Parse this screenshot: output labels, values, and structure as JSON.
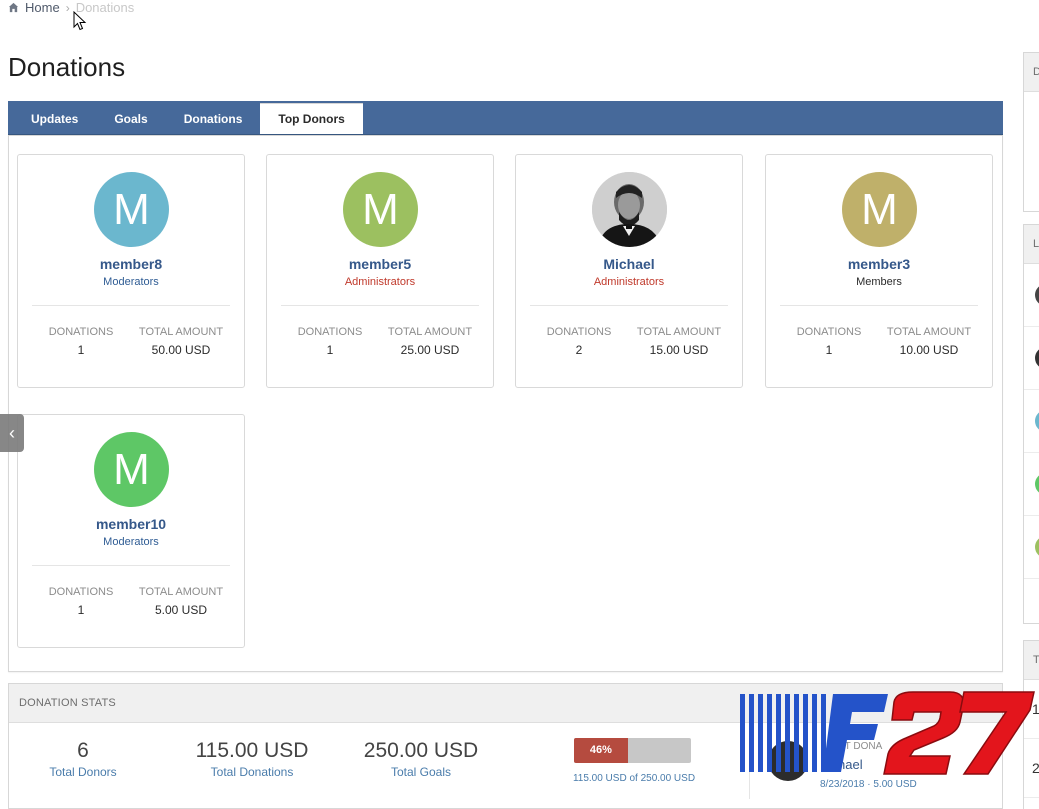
{
  "breadcrumb": {
    "home": "Home",
    "current": "Donations"
  },
  "page_title": "Donations",
  "tabs": [
    {
      "label": "Updates",
      "active": false
    },
    {
      "label": "Goals",
      "active": false
    },
    {
      "label": "Donations",
      "active": false
    },
    {
      "label": "Top Donors",
      "active": true
    }
  ],
  "donors": [
    {
      "avatar_letter": "M",
      "avatar_color": "#6bb7ce",
      "name": "member8",
      "group": "Moderators",
      "donations_label": "DONATIONS",
      "donations": "1",
      "total_label": "TOTAL AMOUNT",
      "total": "50.00 USD"
    },
    {
      "avatar_letter": "M",
      "avatar_color": "#9cc060",
      "name": "member5",
      "group": "Administrators",
      "donations_label": "DONATIONS",
      "donations": "1",
      "total_label": "TOTAL AMOUNT",
      "total": "25.00 USD"
    },
    {
      "avatar_letter": "",
      "avatar_color": "#3a3a3a",
      "name": "Michael",
      "group": "Administrators",
      "donations_label": "DONATIONS",
      "donations": "2",
      "total_label": "TOTAL AMOUNT",
      "total": "15.00 USD"
    },
    {
      "avatar_letter": "M",
      "avatar_color": "#bfb06a",
      "name": "member3",
      "group": "Members",
      "donations_label": "DONATIONS",
      "donations": "1",
      "total_label": "TOTAL AMOUNT",
      "total": "10.00 USD"
    },
    {
      "avatar_letter": "M",
      "avatar_color": "#5ec766",
      "name": "member10",
      "group": "Moderators",
      "donations_label": "DONATIONS",
      "donations": "1",
      "total_label": "TOTAL AMOUNT",
      "total": "5.00 USD"
    }
  ],
  "stats": {
    "header": "DONATION STATS",
    "total_donors": "6",
    "total_donors_label": "Total Donors",
    "total_donations": "115.00 USD",
    "total_donations_label": "Total Donations",
    "total_goals": "250.00 USD",
    "total_goals_label": "Total Goals",
    "progress_percent": 46,
    "progress_label": "46%",
    "progress_caption": "115.00 USD of 250.00 USD",
    "last_donation_label": "ST DONA",
    "last_donation_name": "hael",
    "last_donation_meta": "8/23/2018 · 5.00 USD"
  },
  "sidebar": {
    "header_top": "D",
    "header_middle": "L",
    "header_bottom": "T",
    "row_texts": [
      "1",
      "2"
    ]
  },
  "colors": {
    "tab_bar": "#46699a",
    "progress_fill": "#b54b3f",
    "progress_track": "#c7c7c7",
    "link_blue": "#35588a",
    "admin_red": "#c0392b"
  },
  "watermark_text": "F27",
  "icons": {
    "home": "home-icon",
    "chevron_left": "chevron-left-icon",
    "cursor": "mouse-cursor-icon"
  }
}
